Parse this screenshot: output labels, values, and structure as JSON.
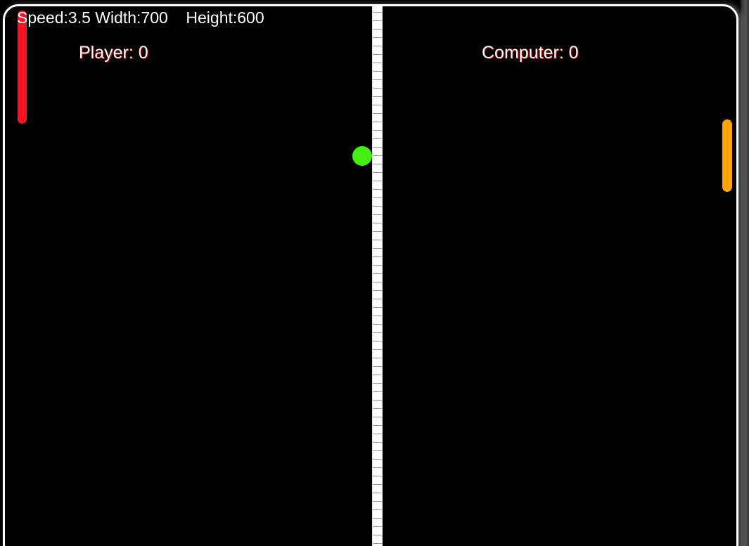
{
  "hud": {
    "speed": "Speed:3.5",
    "width": "Width:700",
    "height": "Height:600"
  },
  "scores": {
    "player_label": "Player: 0",
    "computer_label": "Computer: 0",
    "player": 0,
    "computer": 0
  },
  "colors": {
    "board_background": "#000000",
    "board_border": "#ffffff",
    "net": "#ffffff",
    "player_paddle": "#ff1122",
    "computer_paddle": "#ffa500",
    "ball": "#44ee11"
  }
}
